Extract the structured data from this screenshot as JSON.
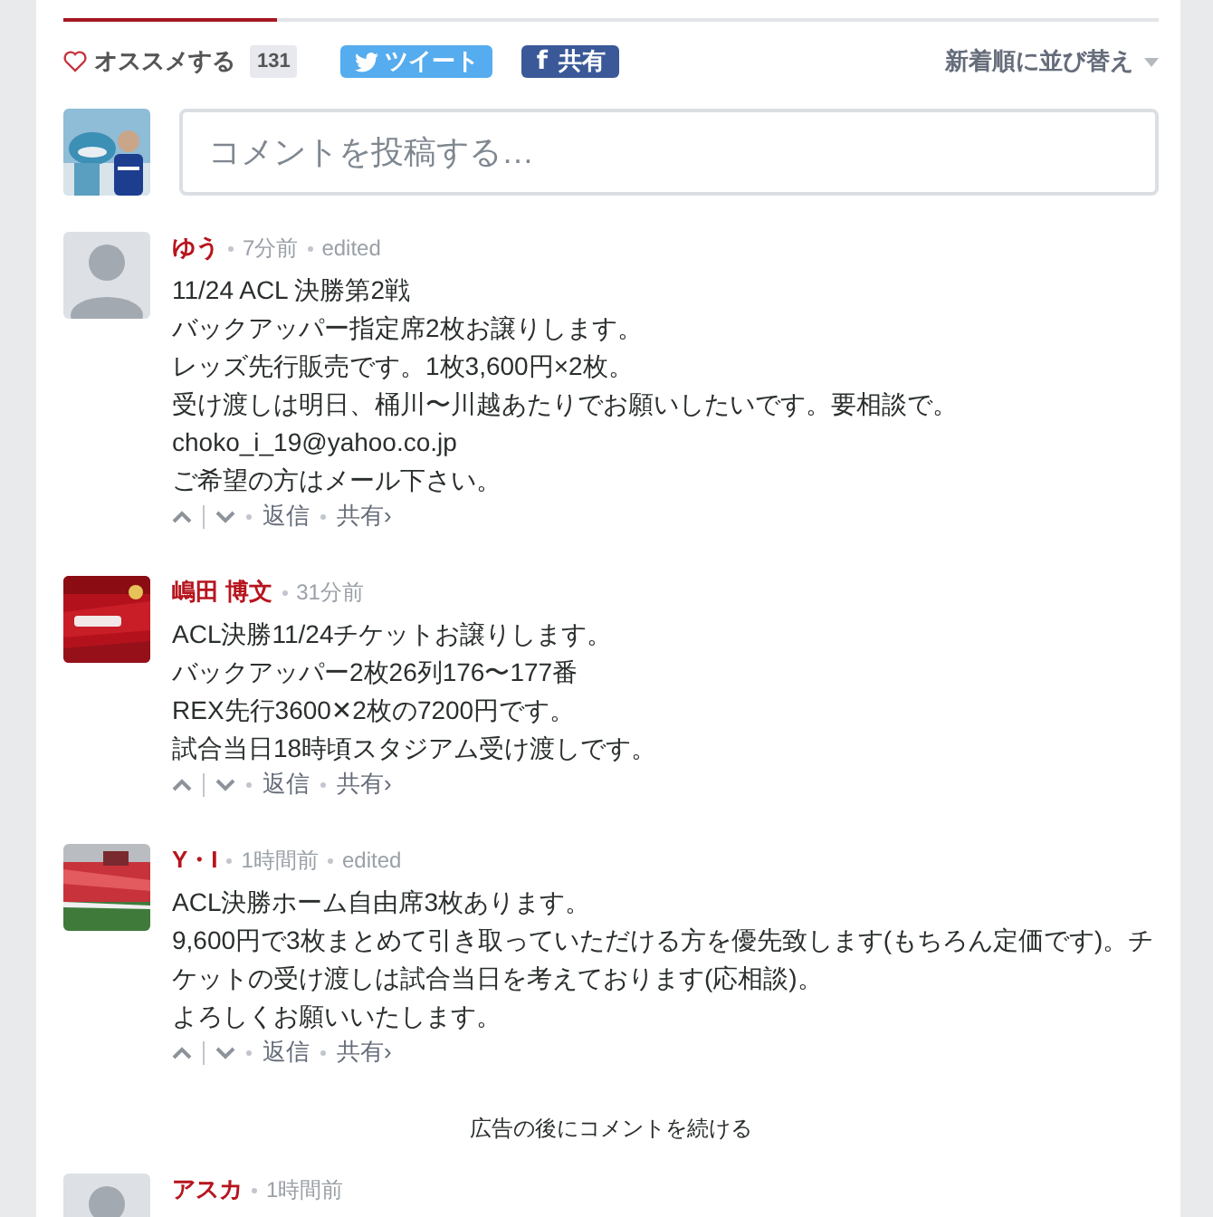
{
  "toolbar": {
    "recommend": {
      "label": "オススメする",
      "count": "131"
    },
    "tweet": {
      "label": "ツイート"
    },
    "facebook": {
      "glyph": "f",
      "label": "共有"
    },
    "sort": {
      "label": "新着順に並び替え"
    }
  },
  "composer": {
    "avatar": {
      "kind": "picture"
    },
    "placeholder": "コメントを投稿する…"
  },
  "comments": [
    {
      "avatar": {
        "kind": "default"
      },
      "author": "ゆう",
      "time": "7分前",
      "edited": "edited",
      "body": [
        "11/24 ACL 決勝第2戦",
        "バックアッパー指定席2枚お譲りします。",
        "レッズ先行販売です。1枚3,600円×2枚。",
        "受け渡しは明日、桶川〜川越あたりでお願いしたいです。要相談で。",
        "choko_i_19@yahoo.co.jp",
        "ご希望の方はメール下さい。"
      ],
      "reply": "返信",
      "share": "共有›"
    },
    {
      "avatar": {
        "kind": "picture"
      },
      "author": "嶋田 博文",
      "time": "31分前",
      "body": [
        "ACL決勝11/24チケットお譲りします。",
        "バックアッパー2枚26列176〜177番",
        "REX先行3600✕2枚の7200円です。",
        "試合当日18時頃スタジアム受け渡しです。"
      ],
      "reply": "返信",
      "share": "共有›"
    },
    {
      "avatar": {
        "kind": "picture"
      },
      "author": "Y・I",
      "time": "1時間前",
      "edited": "edited",
      "body": [
        "ACL決勝ホーム自由席3枚あります。",
        "9,600円で3枚まとめて引き取っていただける方を優先致します(もちろん定価です)。チケットの受け渡しは試合当日を考えております(応相談)。",
        "よろしくお願いいたします。"
      ],
      "reply": "返信",
      "share": "共有›"
    }
  ],
  "ad_notice": "広告の後にコメントを続ける",
  "partial_comment": {
    "avatar": {
      "kind": "default"
    },
    "author": "アスカ",
    "time": "1時間前"
  }
}
